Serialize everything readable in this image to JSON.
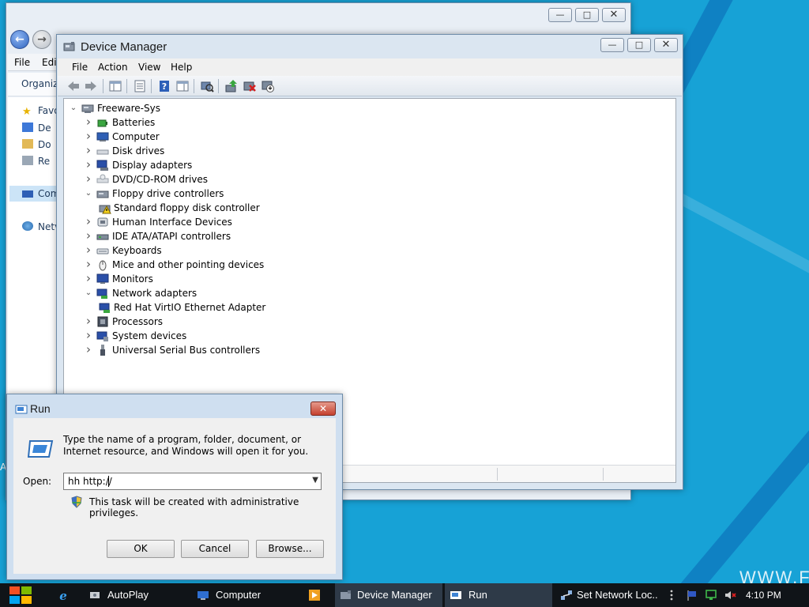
{
  "explorer": {
    "menu": [
      "File",
      "Edit"
    ],
    "organize_label": "Organize",
    "nav_items": [
      "Favo",
      "De",
      "Do",
      "Re",
      "Com",
      "Netv"
    ]
  },
  "device_manager": {
    "title": "Device Manager",
    "menu": [
      "File",
      "Action",
      "View",
      "Help"
    ],
    "root": "Freeware-Sys",
    "tree": [
      {
        "label": "Batteries",
        "icon": "battery-icon",
        "expanded": false
      },
      {
        "label": "Computer",
        "icon": "computer-icon",
        "expanded": false
      },
      {
        "label": "Disk drives",
        "icon": "disk-drive-icon",
        "expanded": false
      },
      {
        "label": "Display adapters",
        "icon": "display-adapter-icon",
        "expanded": false
      },
      {
        "label": "DVD/CD-ROM drives",
        "icon": "dvd-drive-icon",
        "expanded": false
      },
      {
        "label": "Floppy drive controllers",
        "icon": "floppy-controller-icon",
        "expanded": true
      },
      {
        "label": "Standard floppy disk controller",
        "icon": "warning-device-icon",
        "child": true
      },
      {
        "label": "Human Interface Devices",
        "icon": "hid-icon",
        "expanded": false
      },
      {
        "label": "IDE ATA/ATAPI controllers",
        "icon": "ide-controller-icon",
        "expanded": false
      },
      {
        "label": "Keyboards",
        "icon": "keyboard-icon",
        "expanded": false
      },
      {
        "label": "Mice and other pointing devices",
        "icon": "mouse-icon",
        "expanded": false
      },
      {
        "label": "Monitors",
        "icon": "monitor-icon",
        "expanded": false
      },
      {
        "label": "Network adapters",
        "icon": "network-adapter-icon",
        "expanded": true
      },
      {
        "label": "Red Hat VirtIO Ethernet Adapter",
        "icon": "network-card-icon",
        "child": true
      },
      {
        "label": "Processors",
        "icon": "processor-icon",
        "expanded": false
      },
      {
        "label": "System devices",
        "icon": "system-devices-icon",
        "expanded": false
      },
      {
        "label": "Universal Serial Bus controllers",
        "icon": "usb-icon",
        "expanded": false
      }
    ]
  },
  "run": {
    "title": "Run",
    "description": "Type the name of a program, folder, document, or Internet resource, and Windows will open it for you.",
    "open_label": "Open:",
    "open_value": "hh http://",
    "admin_note": "This task will be created with administrative privileges.",
    "ok_label": "OK",
    "cancel_label": "Cancel",
    "browse_label": "Browse..."
  },
  "taskbar": {
    "items": [
      {
        "label": "AutoPlay",
        "icon": "autoplay-icon"
      },
      {
        "label": "Computer",
        "icon": "computer-icon"
      },
      {
        "label": "Device Manager",
        "icon": "device-manager-icon"
      },
      {
        "label": "Run",
        "icon": "run-icon"
      },
      {
        "label": "Set Network Loc...",
        "icon": "network-icon"
      }
    ],
    "clock": "4:10 PM"
  },
  "watermark": "WWW.FR",
  "desktop_letter": "A",
  "colors": {
    "desktop": "#17a2d6",
    "taskbar": "#101418",
    "window_frame": "#dbe6f1",
    "close_red": "#c4412f"
  }
}
